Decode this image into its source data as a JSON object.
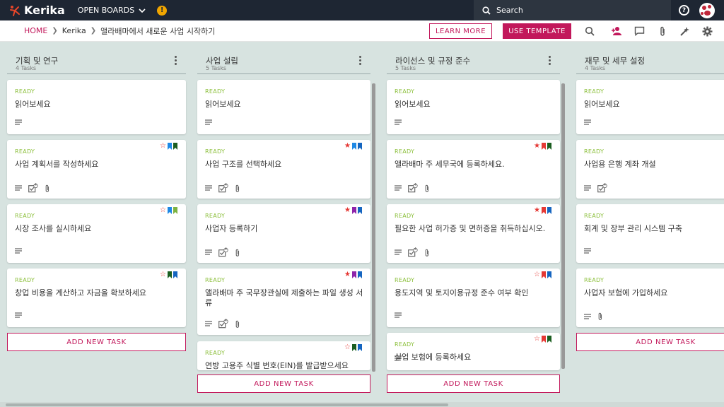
{
  "app": {
    "name": "Kerika"
  },
  "topbar": {
    "open_boards": "OPEN BOARDS",
    "search_placeholder": "Search"
  },
  "breadcrumb": {
    "home": "HOME",
    "workspace": "Kerika",
    "board": "앨라배마에서 새로운 사업 시작하기"
  },
  "actions": {
    "learn_more": "LEARN MORE",
    "use_template": "USE TEMPLATE"
  },
  "colors": {
    "brand": "#c2185b",
    "ready": "#8bbf3a",
    "topbar": "#1e2633",
    "board_bg": "#d7e3e0"
  },
  "columns": [
    {
      "title": "기획 및 연구",
      "count": "4 Tasks",
      "add_label": "ADD NEW TASK",
      "cards": [
        {
          "status": "READY",
          "title": "읽어보세요",
          "star": "none",
          "tags": [],
          "checklist": "",
          "attachment": false
        },
        {
          "status": "READY",
          "title": "사업 계획서를 작성하세요",
          "star": "outline",
          "tags": [
            "#1e88e5",
            "#1b5e20"
          ],
          "checklist": "4",
          "attachment": true
        },
        {
          "status": "READY",
          "title": "시장 조사를 실시하세요",
          "star": "outline",
          "tags": [
            "#1e88e5",
            "#7cb342"
          ],
          "checklist": "",
          "attachment": false
        },
        {
          "status": "READY",
          "title": "창업 비용을 계산하고 자금을 확보하세요",
          "star": "outline",
          "tags": [
            "#1b5e20",
            "#1565c0"
          ],
          "checklist": "",
          "attachment": false
        }
      ]
    },
    {
      "title": "사업 설립",
      "count": "5 Tasks",
      "add_label": "ADD NEW TASK",
      "cards": [
        {
          "status": "READY",
          "title": "읽어보세요",
          "star": "none",
          "tags": [],
          "checklist": "",
          "attachment": false
        },
        {
          "status": "READY",
          "title": "사업 구조를 선택하세요",
          "star": "filled",
          "tags": [
            "#1e88e5",
            "#1565c0"
          ],
          "checklist": "4",
          "attachment": true
        },
        {
          "status": "READY",
          "title": "사업자 등록하기",
          "star": "filled",
          "tags": [
            "#8e24aa",
            "#1565c0"
          ],
          "checklist": "4",
          "attachment": true
        },
        {
          "status": "READY",
          "title": "앨라배마 주 국무장관실에 제출하는 파일 생성 서류",
          "star": "filled",
          "tags": [
            "#8e24aa",
            "#1565c0"
          ],
          "checklist": "4",
          "attachment": true
        },
        {
          "status": "READY",
          "title": "연방 고용주 식별 번호(EIN)를 발급받으세요",
          "star": "outline",
          "tags": [
            "#1b5e20",
            "#1565c0"
          ],
          "checklist": "",
          "attachment": false
        }
      ]
    },
    {
      "title": "라이선스 및 규정 준수",
      "count": "5 Tasks",
      "add_label": "ADD NEW TASK",
      "cards": [
        {
          "status": "READY",
          "title": "읽어보세요",
          "star": "none",
          "tags": [],
          "checklist": "",
          "attachment": false
        },
        {
          "status": "READY",
          "title": "앨라배마 주 세무국에 등록하세요.",
          "star": "filled",
          "tags": [
            "#e53935",
            "#1b5e20"
          ],
          "checklist": "4",
          "attachment": true
        },
        {
          "status": "READY",
          "title": "필요한 사업 허가증 및 면허증을 취득하십시오.",
          "star": "filled",
          "tags": [
            "#e53935",
            "#1565c0"
          ],
          "checklist": "4",
          "attachment": true
        },
        {
          "status": "READY",
          "title": "용도지역 및 토지이용규정 준수 여부 확인",
          "star": "outline",
          "tags": [
            "#e53935",
            "#1565c0"
          ],
          "checklist": "",
          "attachment": false
        },
        {
          "status": "READY",
          "title": "실업 보험에 등록하세요",
          "star": "outline",
          "tags": [
            "#e53935",
            "#1b5e20"
          ],
          "checklist": "",
          "attachment": false
        }
      ]
    },
    {
      "title": "재무 및 세무 설정",
      "count": "4 Tasks",
      "add_label": "ADD NEW TASK",
      "cards": [
        {
          "status": "READY",
          "title": "읽어보세요",
          "star": "none",
          "tags": [],
          "checklist": "",
          "attachment": false
        },
        {
          "status": "READY",
          "title": "사업용 은행 계좌 개설",
          "star": "none",
          "tags": [],
          "checklist": "4",
          "attachment": false
        },
        {
          "status": "READY",
          "title": "회계 및 장부 관리 시스템 구축",
          "star": "none",
          "tags": [],
          "checklist": "",
          "attachment": false
        },
        {
          "status": "READY",
          "title": "사업자 보험에 가입하세요",
          "star": "none",
          "tags": [],
          "checklist": "",
          "attachment": true
        }
      ]
    }
  ]
}
